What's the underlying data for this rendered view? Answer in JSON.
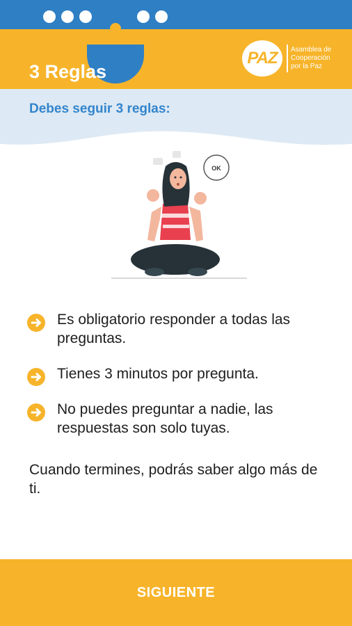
{
  "header": {
    "title": "3 Reglas",
    "logo": {
      "mark": "PAZ",
      "text_line1": "Asamblea de",
      "text_line2": "Cooperación",
      "text_line3": "por la Paz"
    }
  },
  "subheader": {
    "text": "Debes seguir 3 reglas:"
  },
  "illustration": {
    "bubble_text": "OK"
  },
  "rules": [
    {
      "text": "Es obligatorio responder a todas las preguntas."
    },
    {
      "text": "Tienes 3 minutos por pregunta."
    },
    {
      "text": "No puedes preguntar a nadie, las respuestas son solo tuyas."
    }
  ],
  "closing": "Cuando termines, podrás saber algo más de ti.",
  "footer": {
    "button_label": "SIGUIENTE"
  },
  "colors": {
    "blue": "#2f7fc4",
    "yellow": "#f7b42a",
    "light_blue": "#dde9f4"
  }
}
